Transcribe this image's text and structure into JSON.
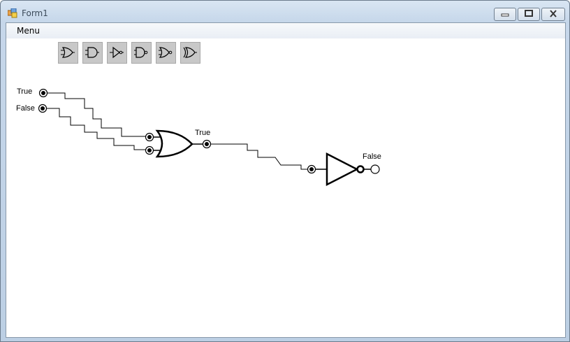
{
  "window": {
    "title": "Form1",
    "icon": "windows-forms-app-icon"
  },
  "menu": {
    "items": [
      {
        "label": "Menu"
      }
    ]
  },
  "toolbar": {
    "buttons": [
      {
        "name": "or-gate-tool",
        "icon": "or-gate-icon"
      },
      {
        "name": "and-gate-tool",
        "icon": "and-gate-icon"
      },
      {
        "name": "not-gate-tool",
        "icon": "not-gate-icon"
      },
      {
        "name": "nand-gate-tool",
        "icon": "nand-gate-icon"
      },
      {
        "name": "nor-gate-tool",
        "icon": "nor-gate-icon"
      },
      {
        "name": "xor-gate-tool",
        "icon": "xor-gate-icon"
      }
    ]
  },
  "circuit": {
    "input1_value": "True",
    "input2_value": "False",
    "or_output_value": "True",
    "not_output_value": "False"
  }
}
